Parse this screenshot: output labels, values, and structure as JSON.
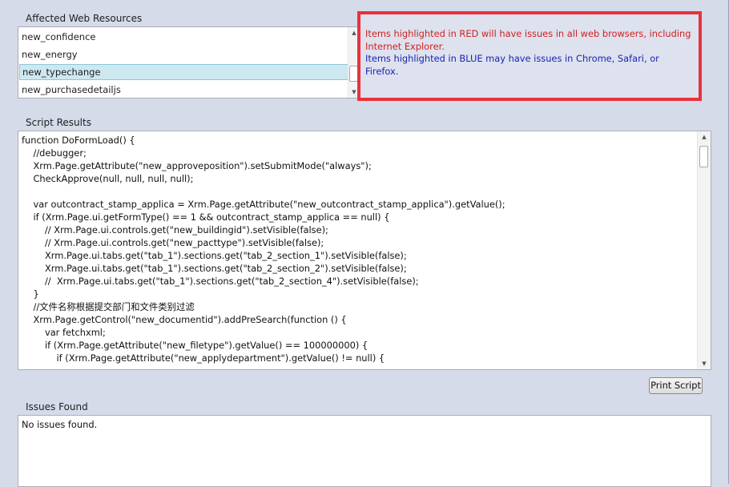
{
  "affected": {
    "label": "Affected Web Resources",
    "items": [
      "new_confidence",
      "new_energy",
      "new_typechange",
      "new_purchasedetailjs"
    ],
    "selected_index": 2
  },
  "notice": {
    "red": "Items highlighted in RED will have issues in all web browsers, including Internet Explorer.",
    "blue": "Items highlighted in BLUE may have issues in Chrome, Safari, or Firefox."
  },
  "script": {
    "label": "Script Results",
    "lines": [
      "function DoFormLoad() {",
      "    //debugger;",
      "    Xrm.Page.getAttribute(\"new_approveposition\").setSubmitMode(\"always\");",
      "    CheckApprove(null, null, null, null);",
      "",
      "    var outcontract_stamp_applica = Xrm.Page.getAttribute(\"new_outcontract_stamp_applica\").getValue();",
      "    if (Xrm.Page.ui.getFormType() == 1 && outcontract_stamp_applica == null) {",
      "        // Xrm.Page.ui.controls.get(\"new_buildingid\").setVisible(false);",
      "        // Xrm.Page.ui.controls.get(\"new_pacttype\").setVisible(false);",
      "        Xrm.Page.ui.tabs.get(\"tab_1\").sections.get(\"tab_2_section_1\").setVisible(false);",
      "        Xrm.Page.ui.tabs.get(\"tab_1\").sections.get(\"tab_2_section_2\").setVisible(false);",
      "        //  Xrm.Page.ui.tabs.get(\"tab_1\").sections.get(\"tab_2_section_4\").setVisible(false);",
      "    }",
      "    //文件名称根据提交部门和文件类别过滤",
      "    Xrm.Page.getControl(\"new_documentid\").addPreSearch(function () {",
      "        var fetchxml;",
      "        if (Xrm.Page.getAttribute(\"new_filetype\").getValue() == 100000000) {",
      "            if (Xrm.Page.getAttribute(\"new_applydepartment\").getValue() != null) {",
      "                                                                   "
    ]
  },
  "print_button": "Print Script",
  "issues": {
    "label": "Issues Found",
    "text": "No issues found."
  },
  "colors": {
    "background": "#d6dbe9",
    "notice_border": "#e8323c",
    "red_text": "#d21f1f",
    "blue_text": "#1c22b5",
    "selection": "#cde8f0"
  },
  "icons": [
    "scroll-up-arrow-icon",
    "scroll-down-arrow-icon"
  ]
}
